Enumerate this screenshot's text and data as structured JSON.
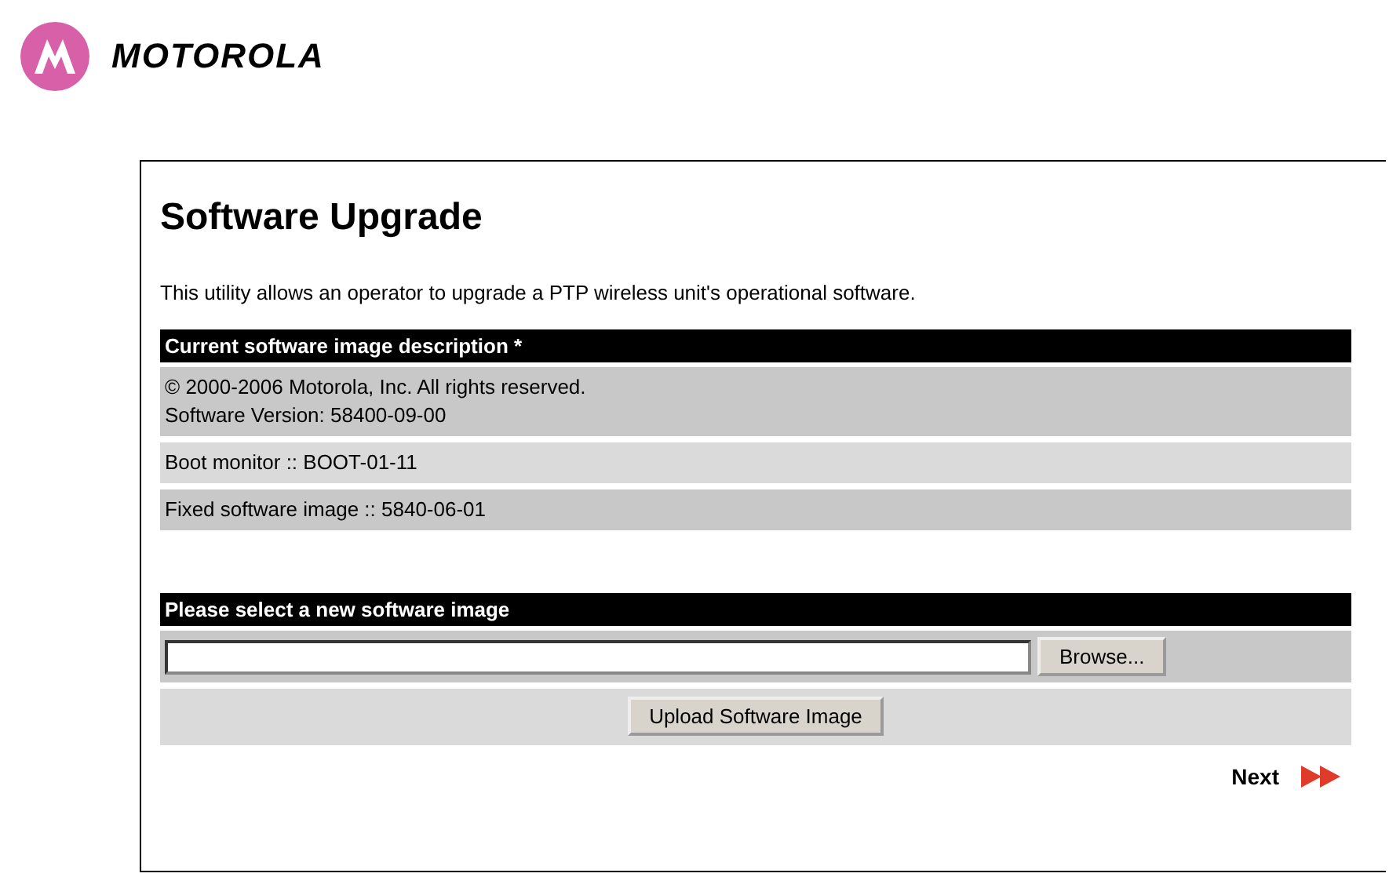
{
  "logo": {
    "text": "MOTOROLA"
  },
  "page": {
    "title": "Software Upgrade",
    "intro": "This utility allows an operator to upgrade a PTP wireless unit's operational software."
  },
  "current_image": {
    "heading": "Current software image description *",
    "rows": [
      {
        "lines": [
          "© 2000-2006 Motorola, Inc. All rights reserved.",
          "Software Version: 58400-09-00"
        ]
      },
      {
        "lines": [
          "Boot monitor :: BOOT-01-11"
        ]
      },
      {
        "lines": [
          "Fixed software image :: 5840-06-01"
        ]
      }
    ]
  },
  "new_image": {
    "heading": "Please select a new software image",
    "browse_button": "Browse...",
    "upload_button": "Upload Software Image"
  },
  "next_link": "Next"
}
